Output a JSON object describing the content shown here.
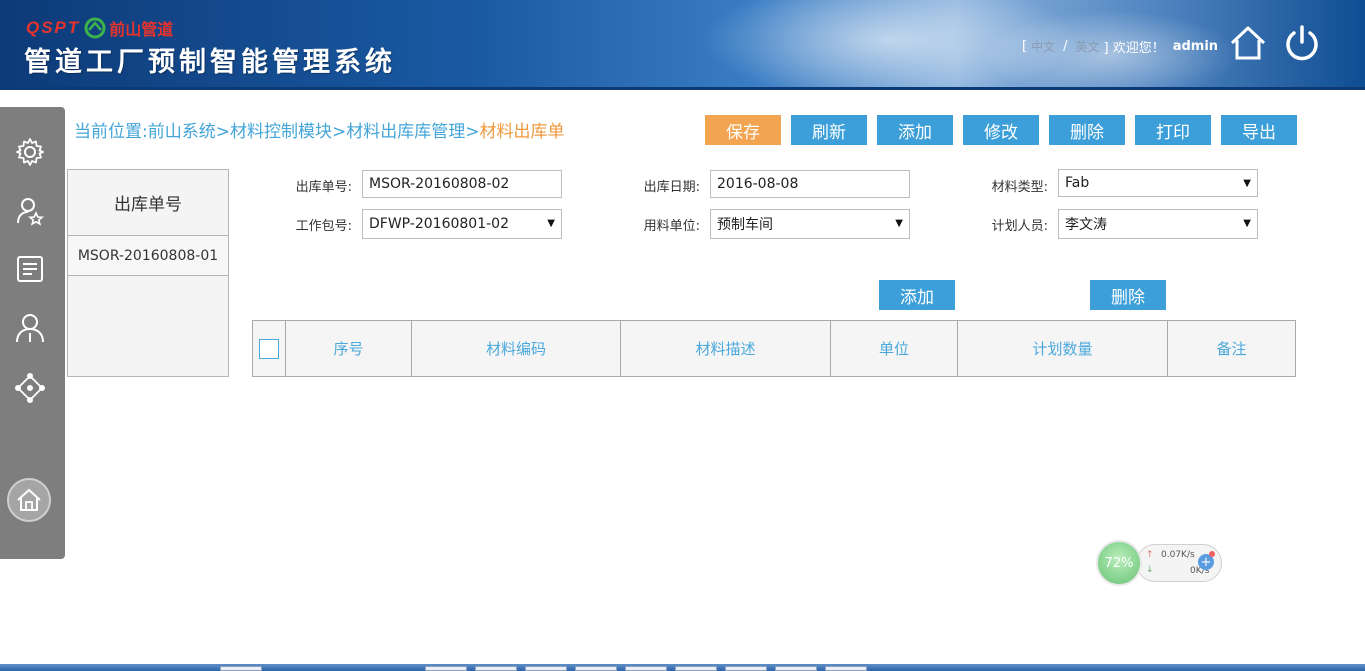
{
  "header": {
    "logo_text": "QSPT",
    "logo_cn": "前山管道",
    "system_title": "管道工厂预制智能管理系统",
    "lang_open_bracket": "[",
    "lang_chinese": "中文",
    "lang_sep": "/",
    "lang_english": "英文",
    "welcome": "] 欢迎您！",
    "user": "admin",
    "icons": [
      "home-icon",
      "power-icon"
    ]
  },
  "sidebar": {
    "items": [
      {
        "icon": "settings-gear-icon"
      },
      {
        "icon": "user-star-icon"
      },
      {
        "icon": "document-list-icon"
      },
      {
        "icon": "person-icon"
      },
      {
        "icon": "network-nodes-icon"
      }
    ],
    "home_icon": "home-circle-icon"
  },
  "breadcrumb": {
    "path": "当前位置:前山系统>材料控制模块>材料出库库管理>",
    "current": "材料出库单"
  },
  "toolbar": {
    "save": "保存",
    "refresh": "刷新",
    "add": "添加",
    "edit": "修改",
    "delete": "删除",
    "print": "打印",
    "export": "导出"
  },
  "list_panel": {
    "header": "出库单号",
    "rows": [
      "MSOR-20160808-01"
    ]
  },
  "form": {
    "order_no_label": "出库单号:",
    "order_no_value": "MSOR-20160808-02",
    "date_label": "出库日期:",
    "date_value": "2016-08-08",
    "material_type_label": "材料类型:",
    "material_type_value": "Fab",
    "work_package_label": "工作包号:",
    "work_package_value": "DFWP-20160801-02",
    "dept_label": "用料单位:",
    "dept_value": "预制车间",
    "planner_label": "计划人员:",
    "planner_value": "李文涛"
  },
  "detail": {
    "add": "添加",
    "delete": "删除",
    "columns": [
      "序号",
      "材料编码",
      "材料描述",
      "单位",
      "计划数量",
      "备注"
    ]
  },
  "net_widget": {
    "percent": "72%",
    "up": "0.07K/s",
    "down": "0K/s"
  },
  "colors": {
    "accent_blue": "#3c9fd9",
    "save_orange": "#f3a451",
    "breadcrumb_blue": "#44a5d8",
    "breadcrumb_current": "#f09a3e",
    "sidebar_gray": "#7e7e7e"
  }
}
